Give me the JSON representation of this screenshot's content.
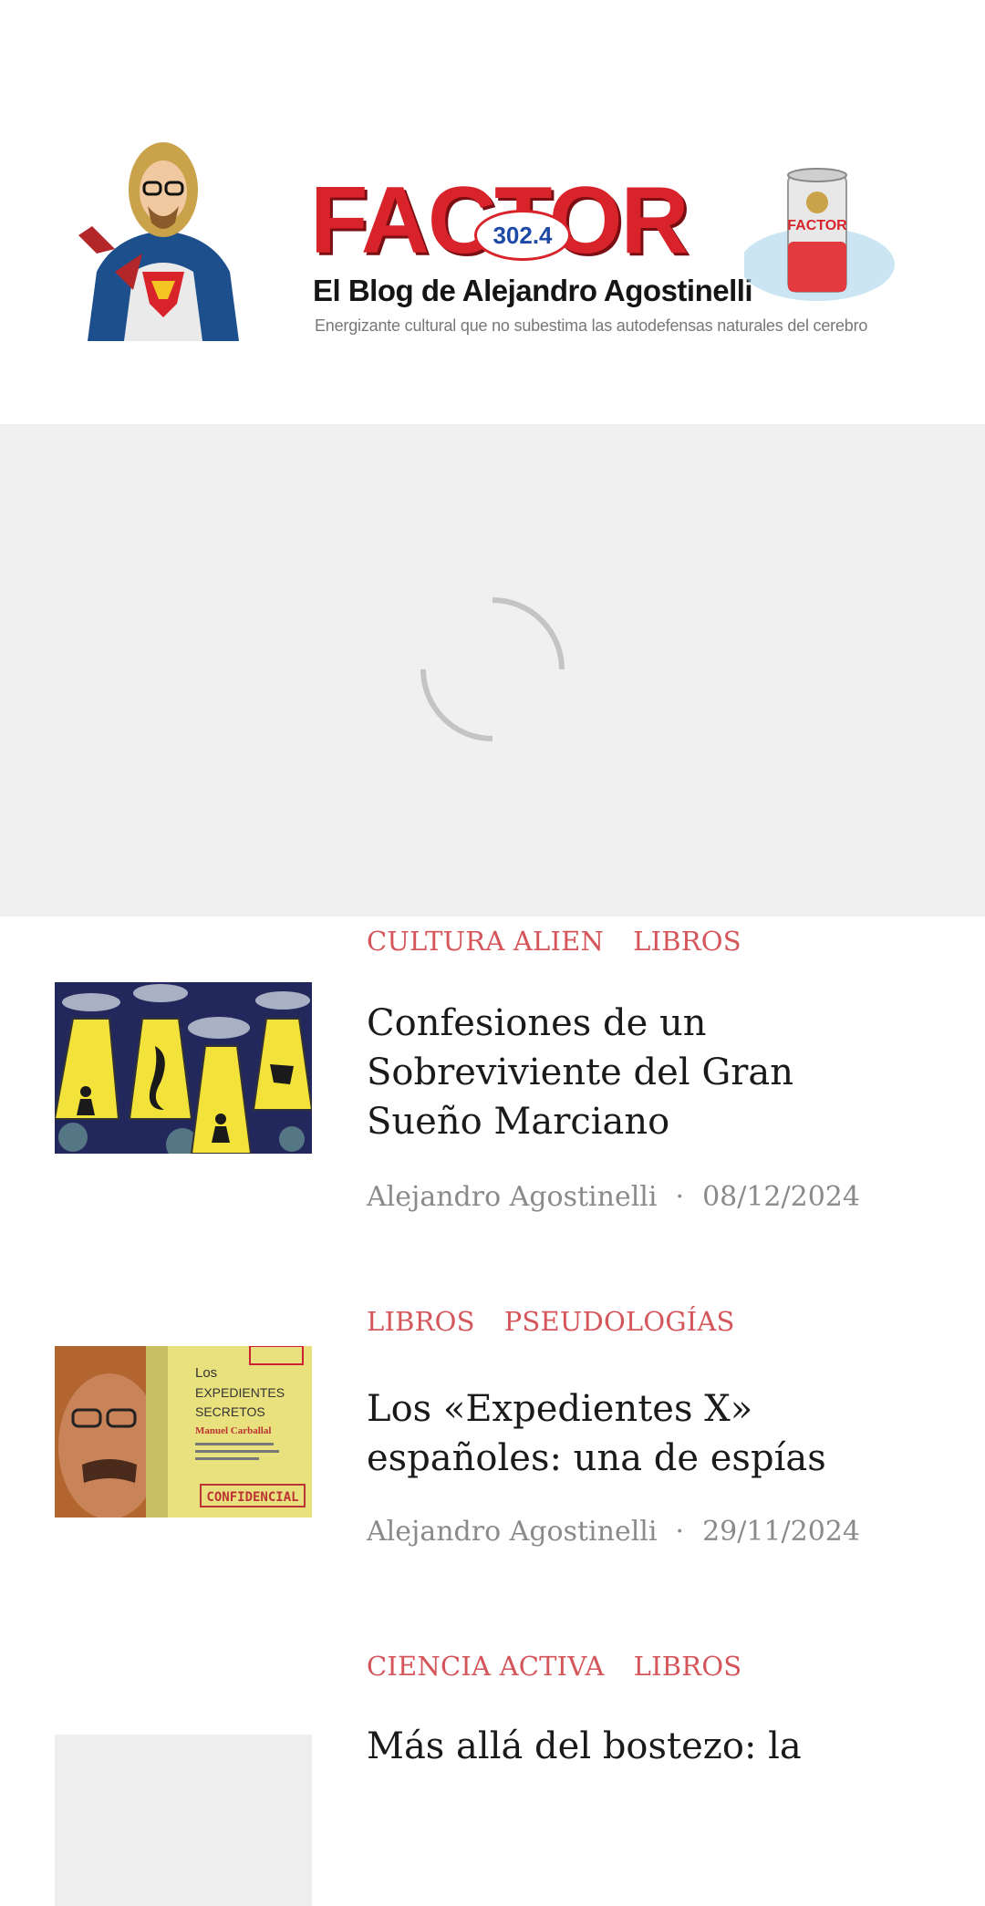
{
  "header": {
    "logo_word": "FACTOR",
    "logo_badge": "302.4",
    "logo_subtitle": "El Blog de Alejandro Agostinelli",
    "logo_tagline": "Energizante cultural que no subestima las autodefensas naturales del cerebro",
    "can_label": "FACTOR"
  },
  "colors": {
    "accent": "#d4555a",
    "logo_red": "#d9232a",
    "placeholder_bg": "#f0f0f0"
  },
  "posts": [
    {
      "categories": [
        "CULTURA ALIEN",
        "LIBROS"
      ],
      "title": "Confesiones de un Sobreviviente del Gran Sueño Marciano",
      "author": "Alejandro Agostinelli",
      "date": "08/12/2024"
    },
    {
      "categories": [
        "LIBROS",
        "PSEUDOLOGÍAS"
      ],
      "title": "Los «Expedientes X» españoles: una de espías",
      "author": "Alejandro Agostinelli",
      "date": "29/11/2024",
      "thumb_text": {
        "l1": "Los",
        "l2": "EXPEDIENTES",
        "l3": "SECRETOS",
        "l4": "Manuel Carballal",
        "stamp": "CONFIDENCIAL"
      }
    },
    {
      "categories": [
        "CIENCIA ACTIVA",
        "LIBROS"
      ],
      "title": "Más allá del bostezo: la",
      "author": "",
      "date": ""
    }
  ]
}
